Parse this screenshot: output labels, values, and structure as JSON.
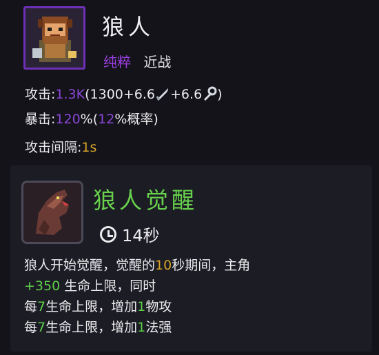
{
  "hero": {
    "name": "狼人",
    "rarity": "纯粹",
    "type": "近战",
    "portrait_icon": "werewolf-portrait-icon"
  },
  "stats": {
    "attack": {
      "label": "攻击:",
      "value": "1.3K",
      "open": "(",
      "base": "1300",
      "plus1": "+6.6",
      "icon1": "sword-icon",
      "plus2": "+6.6",
      "icon2": "staff-icon",
      "close": ")"
    },
    "crit": {
      "label": "暴击:",
      "value": "120",
      "pct_open": "%(",
      "chance": "12",
      "chance_suffix": "%概率)"
    },
    "interval": {
      "label": "攻击间隔:",
      "value": "1s"
    }
  },
  "skill": {
    "name": "狼人觉醒",
    "icon": "howling-wolf-icon",
    "cooldown": "14秒",
    "line1": {
      "a": "狼人开始觉醒，觉醒的",
      "num": "10",
      "b": "秒期间，主角"
    },
    "line2": {
      "num": "+350",
      "b": " 生命上限，同时"
    },
    "line3": {
      "a": "每",
      "num1": "7",
      "b": "生命上限，增加",
      "num2": "1",
      "c": "物攻"
    },
    "line4": {
      "a": "每",
      "num1": "7",
      "b": "生命上限，增加",
      "num2": "1",
      "c": "法强"
    }
  },
  "colors": {
    "rarity_purple": "#9b3fe0",
    "value_purple": "#8a46d8",
    "gold": "#d9a52a",
    "green": "#5ed24a",
    "skill_green": "#68d24c"
  }
}
